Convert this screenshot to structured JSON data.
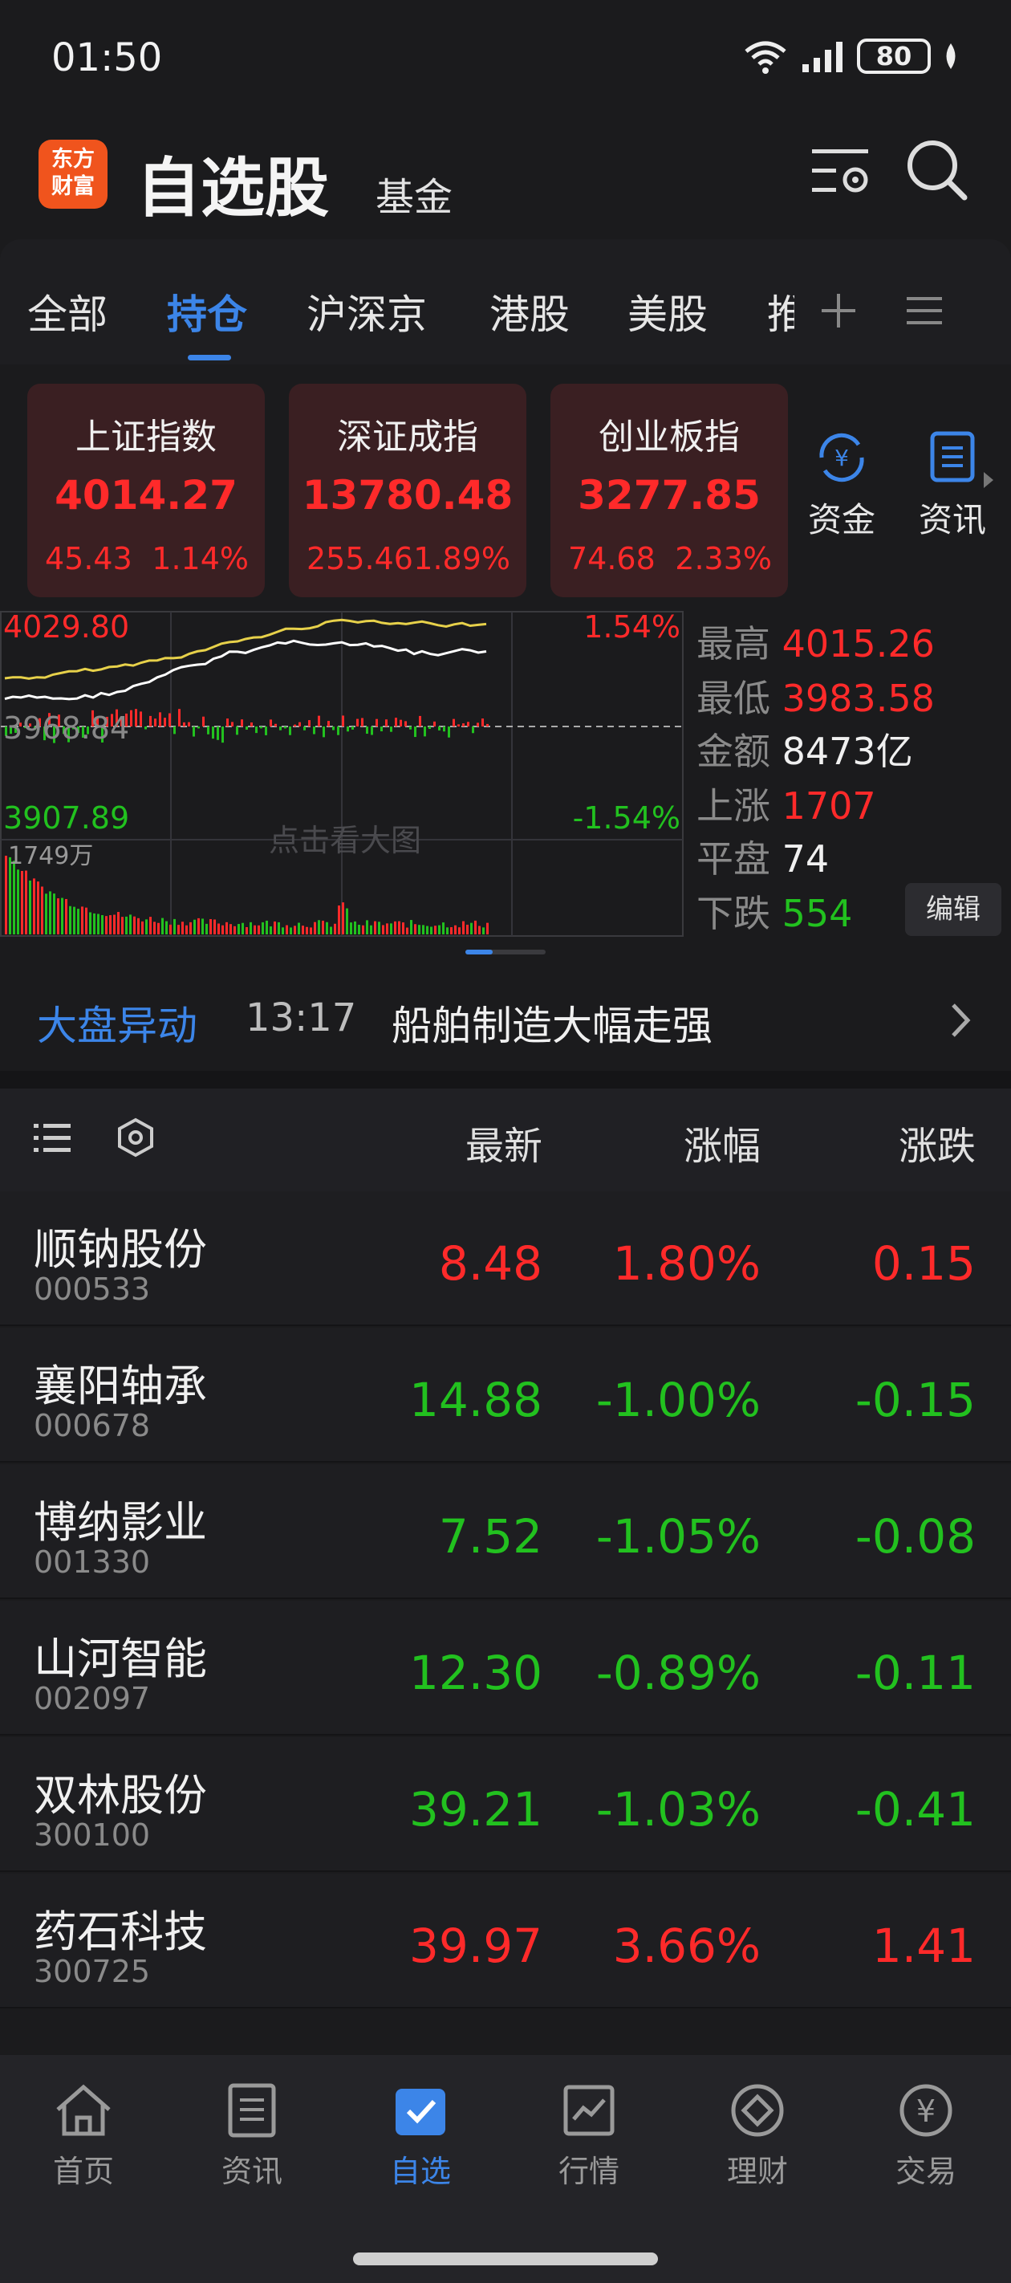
{
  "status": {
    "time": "01:50",
    "battery": "80"
  },
  "header": {
    "logo_line1": "东方",
    "logo_line2": "财富",
    "title": "自选股",
    "subtitle": "基金"
  },
  "tabs": [
    {
      "label": "全部"
    },
    {
      "label": "持仓"
    },
    {
      "label": "沪深京"
    },
    {
      "label": "港股"
    },
    {
      "label": "美股"
    },
    {
      "label": "推"
    }
  ],
  "indices": [
    {
      "name": "上证指数",
      "value": "4014.27",
      "change": "45.43",
      "pct": "1.14%"
    },
    {
      "name": "深证成指",
      "value": "13780.48",
      "change": "255.46",
      "pct": "1.89%"
    },
    {
      "name": "创业板指",
      "value": "3277.85",
      "change": "74.68",
      "pct": "2.33%"
    }
  ],
  "side_buttons": {
    "fund": "资金",
    "news": "资讯"
  },
  "chart": {
    "high_label": "4029.80",
    "mid_label": "3968.84",
    "low_label": "3907.89",
    "high_pct": "1.54%",
    "low_pct": "-1.54%",
    "volume_label": "1749万",
    "hint": "点击看大图"
  },
  "stats": [
    {
      "k": "最高",
      "v": "4015.26",
      "color": "red"
    },
    {
      "k": "最低",
      "v": "3983.58",
      "color": "red"
    },
    {
      "k": "金额",
      "v": "8473亿",
      "color": "white"
    },
    {
      "k": "上涨",
      "v": "1707",
      "color": "red"
    },
    {
      "k": "平盘",
      "v": "74",
      "color": "white"
    },
    {
      "k": "下跌",
      "v": "554",
      "color": "green"
    }
  ],
  "edit_label": "编辑",
  "alert": {
    "label": "大盘异动",
    "time": "13:17",
    "text": "船舶制造大幅走强"
  },
  "list_header": {
    "latest": "最新",
    "pct": "涨幅",
    "change": "涨跌"
  },
  "stocks": [
    {
      "name": "顺钠股份",
      "code": "000533",
      "price": "8.48",
      "pct": "1.80%",
      "chg": "0.15",
      "up": true
    },
    {
      "name": "襄阳轴承",
      "code": "000678",
      "price": "14.88",
      "pct": "-1.00%",
      "chg": "-0.15",
      "up": false
    },
    {
      "name": "博纳影业",
      "code": "001330",
      "price": "7.52",
      "pct": "-1.05%",
      "chg": "-0.08",
      "up": false
    },
    {
      "name": "山河智能",
      "code": "002097",
      "price": "12.30",
      "pct": "-0.89%",
      "chg": "-0.11",
      "up": false
    },
    {
      "name": "双林股份",
      "code": "300100",
      "price": "39.21",
      "pct": "-1.03%",
      "chg": "-0.41",
      "up": false
    },
    {
      "name": "药石科技",
      "code": "300725",
      "price": "39.97",
      "pct": "3.66%",
      "chg": "1.41",
      "up": true
    }
  ],
  "nav": [
    {
      "label": "首页"
    },
    {
      "label": "资讯"
    },
    {
      "label": "自选"
    },
    {
      "label": "行情"
    },
    {
      "label": "理财"
    },
    {
      "label": "交易"
    }
  ],
  "colors": {
    "accent": "#3c85e8",
    "up": "#ff2a2a",
    "down": "#22c11f",
    "brand": "#f0541d"
  }
}
